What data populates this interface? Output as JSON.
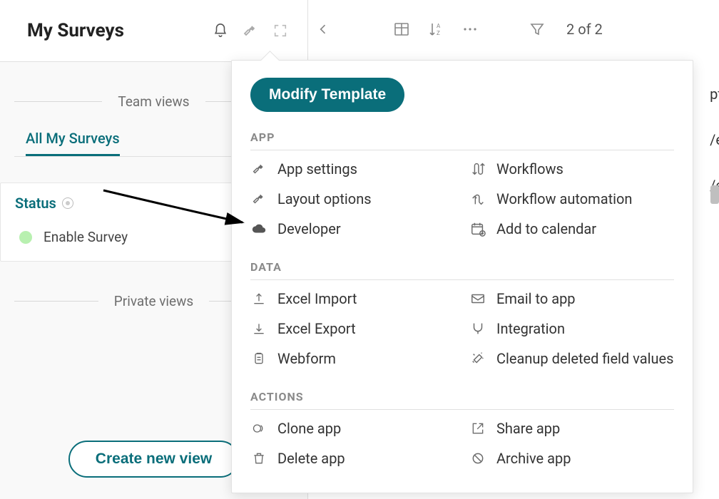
{
  "page_title": "My Surveys",
  "team_views_label": "Team views",
  "private_views_label": "Private views",
  "active_view": "All My Surveys",
  "status": {
    "label": "Status",
    "items": [
      "Enable Survey"
    ]
  },
  "create_view_btn": "Create new view",
  "toolbar": {
    "counter": "2 of 2"
  },
  "panel": {
    "modify_btn": "Modify Template",
    "sections": {
      "app": {
        "label": "APP",
        "items_left": [
          "App settings",
          "Layout options",
          "Developer"
        ],
        "items_right": [
          "Workflows",
          "Workflow automation",
          "Add to calendar"
        ]
      },
      "data": {
        "label": "DATA",
        "items_left": [
          "Excel Import",
          "Excel Export",
          "Webform"
        ],
        "items_right": [
          "Email to app",
          "Integration",
          "Cleanup deleted field values"
        ]
      },
      "actions": {
        "label": "ACTIONS",
        "items_left": [
          "Clone app",
          "Delete app"
        ],
        "items_right": [
          "Share app",
          "Archive app"
        ]
      }
    }
  },
  "edge_hints": [
    "pt",
    "/e",
    "/e"
  ]
}
